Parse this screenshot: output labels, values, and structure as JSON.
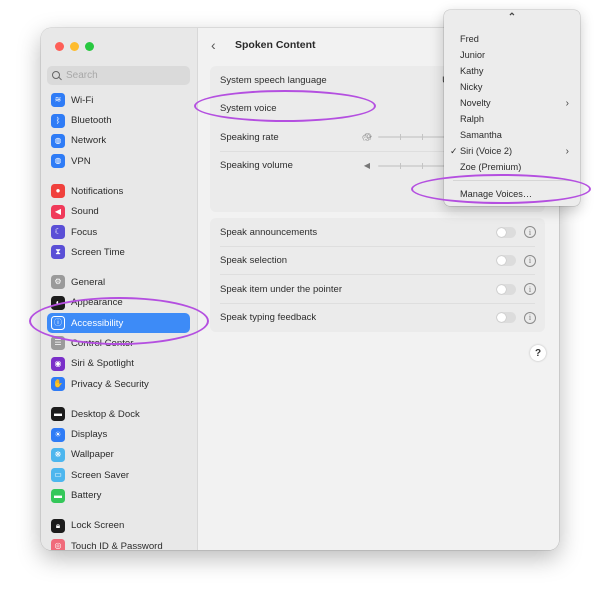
{
  "window": {
    "title": "Spoken Content"
  },
  "sidebar": {
    "search_placeholder": "Search",
    "items": [
      {
        "label": "Wi-Fi",
        "icon": "wifi-icon",
        "color": "#2f7cf6",
        "glyph": "≋"
      },
      {
        "label": "Bluetooth",
        "icon": "bluetooth-icon",
        "color": "#2f7cf6",
        "glyph": "ᛒ"
      },
      {
        "label": "Network",
        "icon": "network-icon",
        "color": "#2f7cf6",
        "glyph": "◍"
      },
      {
        "label": "VPN",
        "icon": "vpn-icon",
        "color": "#2f7cf6",
        "glyph": "◍"
      },
      {
        "label": "Notifications",
        "icon": "notifications-icon",
        "color": "#f0413d",
        "glyph": "●"
      },
      {
        "label": "Sound",
        "icon": "sound-icon",
        "color": "#f03a5a",
        "glyph": "◀"
      },
      {
        "label": "Focus",
        "icon": "focus-icon",
        "color": "#5a4fd6",
        "glyph": "☾"
      },
      {
        "label": "Screen Time",
        "icon": "screen-time-icon",
        "color": "#5a4fd6",
        "glyph": "⧗"
      },
      {
        "label": "General",
        "icon": "general-icon",
        "color": "#9a9a9a",
        "glyph": "⚙"
      },
      {
        "label": "Appearance",
        "icon": "appearance-icon",
        "color": "#1c1c1c",
        "glyph": "◐"
      },
      {
        "label": "Accessibility",
        "icon": "accessibility-icon",
        "color": "#3d8bf7",
        "glyph": "ⓘ"
      },
      {
        "label": "Control Center",
        "icon": "control-center-icon",
        "color": "#9a9a9a",
        "glyph": "☰"
      },
      {
        "label": "Siri & Spotlight",
        "icon": "siri-icon",
        "color": "#7a2fc9",
        "glyph": "◉"
      },
      {
        "label": "Privacy & Security",
        "icon": "privacy-icon",
        "color": "#2f7cf6",
        "glyph": "✋"
      },
      {
        "label": "Desktop & Dock",
        "icon": "desktop-dock-icon",
        "color": "#1c1c1c",
        "glyph": "▬"
      },
      {
        "label": "Displays",
        "icon": "displays-icon",
        "color": "#2f7cf6",
        "glyph": "☀"
      },
      {
        "label": "Wallpaper",
        "icon": "wallpaper-icon",
        "color": "#4db6ee",
        "glyph": "❋"
      },
      {
        "label": "Screen Saver",
        "icon": "screen-saver-icon",
        "color": "#4db6ee",
        "glyph": "▭"
      },
      {
        "label": "Battery",
        "icon": "battery-icon",
        "color": "#34c759",
        "glyph": "▬"
      },
      {
        "label": "Lock Screen",
        "icon": "lock-screen-icon",
        "color": "#1c1c1c",
        "glyph": "🔒︎"
      },
      {
        "label": "Touch ID & Password",
        "icon": "touch-id-icon",
        "color": "#f06a7a",
        "glyph": "◎"
      }
    ],
    "active": "Accessibility"
  },
  "main": {
    "back_label": "‹",
    "title": "Spoken Content",
    "speech_group": {
      "language_label": "System speech language",
      "language_value": "Use",
      "voice_label": "System voice",
      "rate_label": "Speaking rate",
      "rate_icon": "turtle-icon",
      "volume_label": "Speaking volume",
      "volume_icon": "speaker-icon"
    },
    "toggles": [
      {
        "label": "Speak announcements",
        "on": false
      },
      {
        "label": "Speak selection",
        "on": false
      },
      {
        "label": "Speak item under the pointer",
        "on": false
      },
      {
        "label": "Speak typing feedback",
        "on": false
      }
    ],
    "info_glyph": "i",
    "help_glyph": "?"
  },
  "voice_menu": {
    "scroll_up": "⌃",
    "items": [
      {
        "label": "Fred",
        "checked": false,
        "submenu": false
      },
      {
        "label": "Junior",
        "checked": false,
        "submenu": false
      },
      {
        "label": "Kathy",
        "checked": false,
        "submenu": false
      },
      {
        "label": "Nicky",
        "checked": false,
        "submenu": false
      },
      {
        "label": "Novelty",
        "checked": false,
        "submenu": true
      },
      {
        "label": "Ralph",
        "checked": false,
        "submenu": false
      },
      {
        "label": "Samantha",
        "checked": false,
        "submenu": false
      },
      {
        "label": "Siri (Voice 2)",
        "checked": true,
        "submenu": true
      },
      {
        "label": "Zoe (Premium)",
        "checked": false,
        "submenu": false
      }
    ],
    "manage_label": "Manage Voices…",
    "check_glyph": "✓",
    "submenu_glyph": "›"
  },
  "annotation_color": "#b44fe0"
}
